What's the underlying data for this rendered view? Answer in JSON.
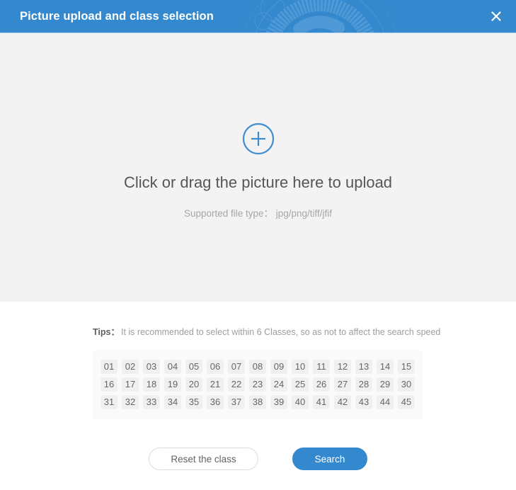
{
  "header": {
    "title": "Picture upload and class selection",
    "close_icon": "close-icon",
    "bg_color": "#3488cd",
    "title_color": "#ffffff",
    "decoration": "radial-tick-sunburst"
  },
  "upload": {
    "icon": "plus-circle-icon",
    "icon_color": "#3d8dd0",
    "main_text": "Click or drag the picture here to upload",
    "sub_text": "Supported file type： jpg/png/tiff/jfif",
    "bg_color": "#f3f3f3"
  },
  "tips": {
    "label": "Tips：",
    "text": "It is recommended to select within 6 Classes, so as not to affect the search speed"
  },
  "classes": {
    "items": [
      "01",
      "02",
      "03",
      "04",
      "05",
      "06",
      "07",
      "08",
      "09",
      "10",
      "11",
      "12",
      "13",
      "14",
      "15",
      "16",
      "17",
      "18",
      "19",
      "20",
      "21",
      "22",
      "23",
      "24",
      "25",
      "26",
      "27",
      "28",
      "29",
      "30",
      "31",
      "32",
      "33",
      "34",
      "35",
      "36",
      "37",
      "38",
      "39",
      "40",
      "41",
      "42",
      "43",
      "44",
      "45"
    ],
    "selected": [],
    "chip_bg": "#f0f0f0",
    "chip_color": "#666666",
    "container_bg": "#fafafa"
  },
  "footer": {
    "reset_label": "Reset the class",
    "search_label": "Search",
    "search_bg": "#3488cd"
  }
}
